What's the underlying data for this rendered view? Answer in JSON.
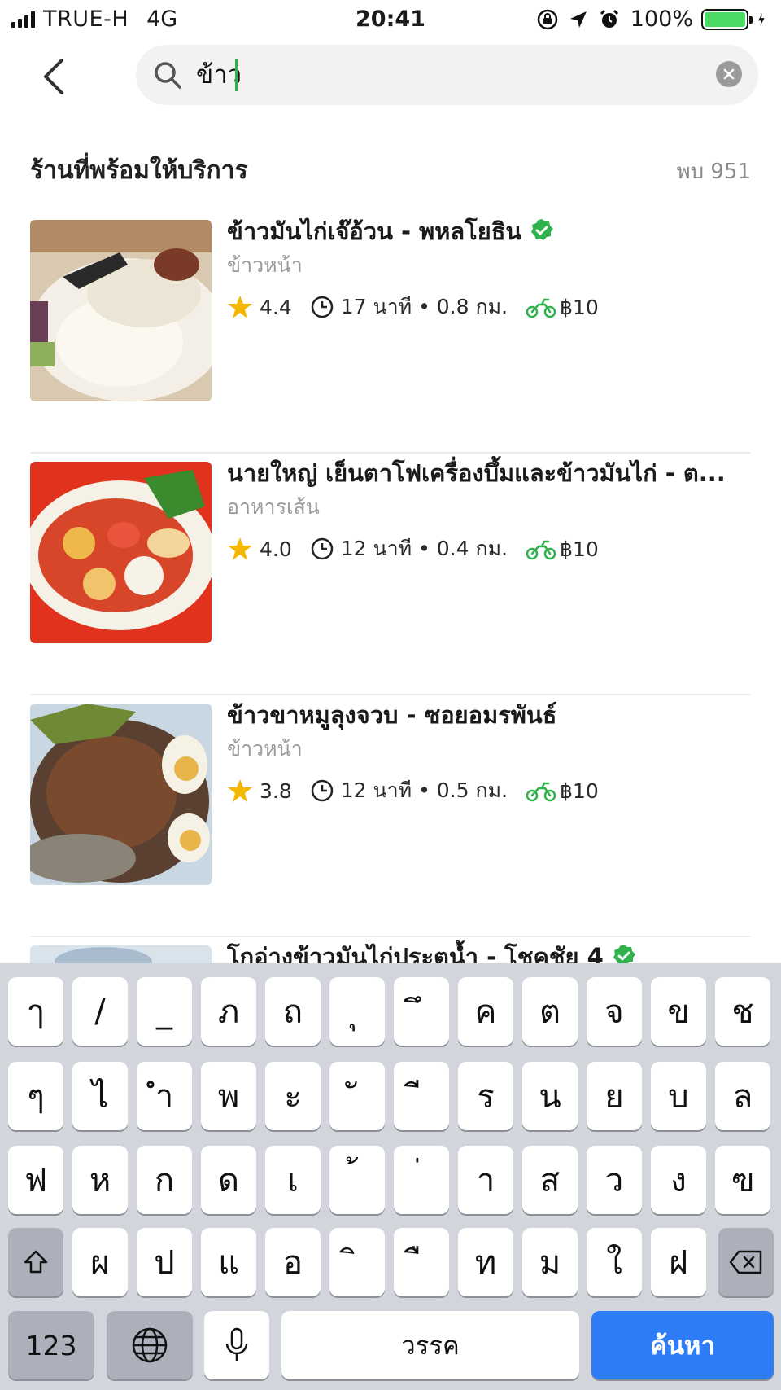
{
  "status_bar": {
    "carrier": "TRUE-H",
    "network": "4G",
    "time": "20:41",
    "battery_percent": "100%",
    "battery_level": 1.0
  },
  "search": {
    "query": "ข้าว",
    "back_icon": "chevron-left-icon",
    "search_icon": "search-icon",
    "clear_icon": "clear-icon"
  },
  "section": {
    "title": "ร้านที่พร้อมให้บริการ",
    "count": "พบ 951"
  },
  "results": [
    {
      "name": "ข้าวมันไก่เจ๊อ้วน - พหลโยธิน",
      "verified": true,
      "category": "ข้าวหน้า",
      "rating": "4.4",
      "eta_distance": "17 นาที • 0.8 กม.",
      "delivery_fee": "฿10",
      "thumb_colors": [
        "#f3ece0",
        "#e8e2d4",
        "#5a3a2e"
      ]
    },
    {
      "name": "นายใหญ่ เย็นตาโฟเครื่องบึ้มและข้าวมันไก่ - ต...",
      "verified": false,
      "category": "อาหารเส้น",
      "rating": "4.0",
      "eta_distance": "12 นาที • 0.4 กม.",
      "delivery_fee": "฿10",
      "thumb_colors": [
        "#e0321c",
        "#f7f1e8",
        "#f0b84a"
      ]
    },
    {
      "name": "ข้าวขาหมูลุงจวบ - ซอยอมรพันธ์",
      "verified": false,
      "category": "ข้าวหน้า",
      "rating": "3.8",
      "eta_distance": "12 นาที • 0.5 กม.",
      "delivery_fee": "฿10",
      "thumb_colors": [
        "#6a4a32",
        "#c9d7e3",
        "#e8b44c"
      ]
    },
    {
      "name": "โกอ่างข้าวมันไก่ประตูน้ำ - โชคชัย 4",
      "verified": true,
      "category": "",
      "rating": "",
      "eta_distance": "",
      "delivery_fee": "",
      "thumb_colors": [
        "#d9e3ec",
        "#c5d2df",
        "#a9bccd"
      ]
    }
  ],
  "keyboard": {
    "row1": [
      "ๅ",
      "/",
      "_",
      "ภ",
      "ถ",
      "ุ",
      "ึ",
      "ค",
      "ต",
      "จ",
      "ข",
      "ช"
    ],
    "row2": [
      "ๆ",
      "ไ",
      "ำ",
      "พ",
      "ะ",
      "ั",
      "ี",
      "ร",
      "น",
      "ย",
      "บ",
      "ล"
    ],
    "row3": [
      "ฟ",
      "ห",
      "ก",
      "ด",
      "เ",
      "้",
      "่",
      "า",
      "ส",
      "ว",
      "ง",
      "ฃ"
    ],
    "row4": [
      "ผ",
      "ป",
      "แ",
      "อ",
      "ิ",
      "ื",
      "ท",
      "ม",
      "ใ",
      "ฝ"
    ],
    "numbers_label": "123",
    "space_label": "วรรค",
    "search_label": "ค้นหา",
    "shift_icon": "shift-icon",
    "backspace_icon": "backspace-icon",
    "globe_icon": "globe-icon",
    "mic_icon": "microphone-icon"
  },
  "colors": {
    "accent_green": "#2fb14c",
    "keyboard_bg": "#d2d5db",
    "search_key_blue": "#2f7df6",
    "star_yellow": "#f5b800"
  }
}
